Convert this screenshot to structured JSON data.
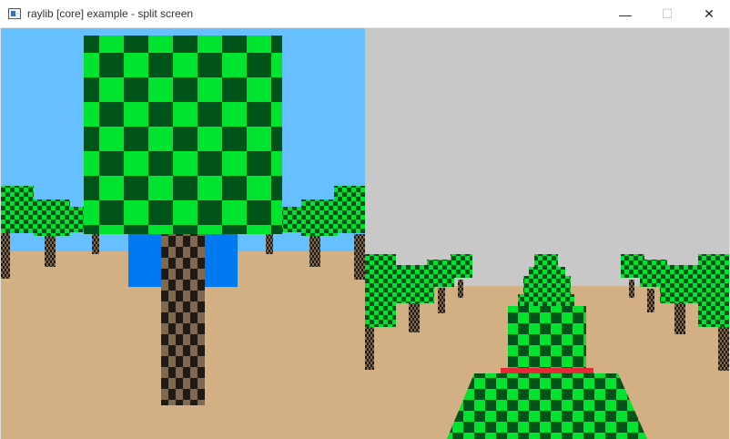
{
  "window": {
    "title": "raylib [core] example - split screen",
    "minimize_glyph": "—",
    "maximize_glyph": "☐",
    "close_glyph": "✕"
  },
  "scene": {
    "colors": {
      "sky_left": "#66bfff",
      "sky_right": "#c8c8c8",
      "ground": "#d3b083",
      "checker_light": "#00e430",
      "checker_dark": "#005419",
      "trunk_light": "#7f6a4f",
      "trunk_dark": "#1f1a15",
      "player_blue": "#0079f1",
      "player_red": "#e62937"
    }
  }
}
